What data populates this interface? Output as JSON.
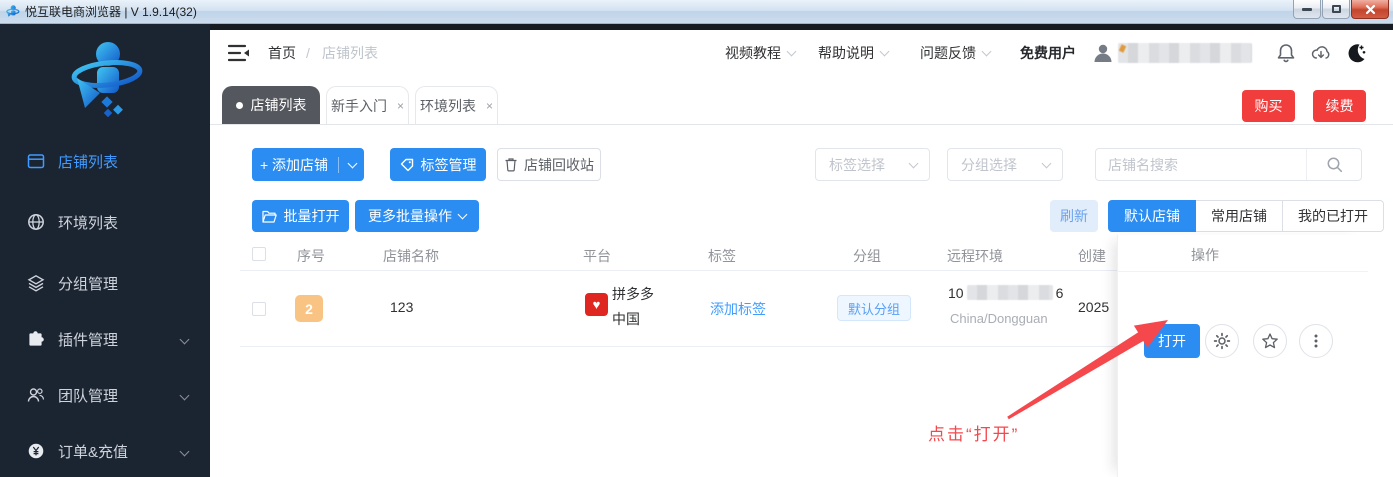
{
  "titlebar": {
    "app_title": "悦互联电商浏览器 | V 1.9.14(32)"
  },
  "sidebar": {
    "items": [
      {
        "label": "店铺列表",
        "active": true
      },
      {
        "label": "环境列表"
      },
      {
        "label": "分组管理"
      },
      {
        "label": "插件管理",
        "expandable": true
      },
      {
        "label": "团队管理",
        "expandable": true
      },
      {
        "label": "订单&充值",
        "expandable": true
      }
    ]
  },
  "topnav": {
    "breadcrumb": {
      "home": "首页",
      "separator": "/",
      "current": "店铺列表"
    },
    "menus": [
      {
        "label": "视频教程"
      },
      {
        "label": "帮助说明"
      },
      {
        "label": "问题反馈"
      }
    ],
    "user_badge": "免费用户"
  },
  "tabs": [
    {
      "label": "店铺列表",
      "active": true
    },
    {
      "label": "新手入门",
      "closable": true
    },
    {
      "label": "环境列表",
      "closable": true
    }
  ],
  "top_actions": {
    "buy": "购买",
    "renew": "续费"
  },
  "toolbar": {
    "add_shop": "+ 添加店铺",
    "tag_manage": "标签管理",
    "recycle_bin": "店铺回收站",
    "batch_open": "批量打开",
    "more_batch": "更多批量操作",
    "refresh": "刷新",
    "view_tabs": [
      {
        "label": "默认店铺",
        "active": true
      },
      {
        "label": "常用店铺"
      },
      {
        "label": "我的已打开"
      }
    ]
  },
  "filters": {
    "tag_select": "标签选择",
    "group_select": "分组选择",
    "search_placeholder": "店铺名搜索"
  },
  "table": {
    "headers": [
      "序号",
      "店铺名称",
      "平台",
      "标签",
      "分组",
      "远程环境",
      "创建",
      "操作"
    ],
    "row": {
      "index": "2",
      "shop_name": "123",
      "platform": "拼多多",
      "platform_region": "中国",
      "platform_logo": "♥",
      "add_tag": "添加标签",
      "group": "默认分组",
      "ip_prefix": "10",
      "ip_suffix": "6",
      "location": "China/Dongguan",
      "created": "2025",
      "open": "打开"
    }
  },
  "annotation": {
    "text": "点击“打开”"
  },
  "ui": {
    "close_glyph": "×"
  },
  "colors": {
    "accent_blue": "#2b8df2",
    "danger_red": "#f23d3d",
    "sidebar_bg": "#1b2431",
    "annotation_red": "#f4484d",
    "link_blue": "#409eff",
    "badge_orange": "#f9c383",
    "pdd_red": "#e02620"
  }
}
